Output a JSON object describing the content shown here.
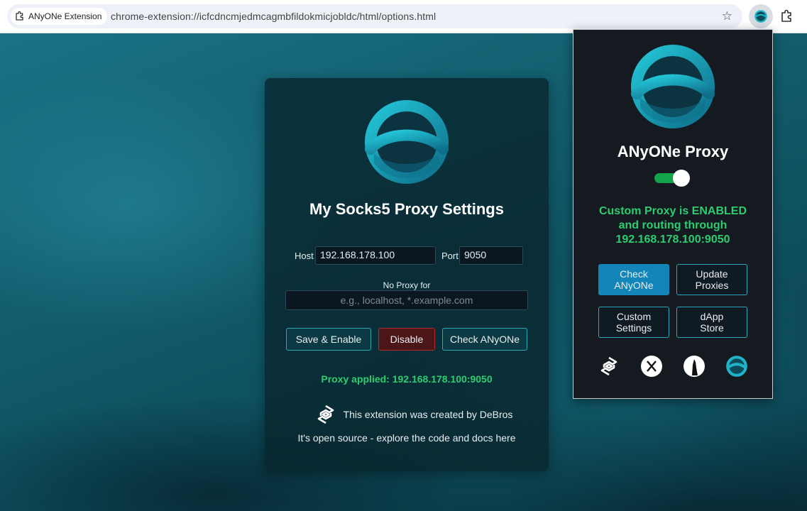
{
  "browser": {
    "site_chip": "ANyONe Extension",
    "url": "chrome-extension://icfcdncmjedmcagmbfildokmicjobldc/html/options.html"
  },
  "options": {
    "title": "My Socks5 Proxy Settings",
    "host_label": "Host",
    "host_value": "192.168.178.100",
    "port_label": "Port",
    "port_value": "9050",
    "noproxy_label": "No Proxy for",
    "noproxy_placeholder": "e.g., localhost, *.example.com",
    "buttons": {
      "save": "Save & Enable",
      "disable": "Disable",
      "check": "Check ANyONe"
    },
    "status": "Proxy applied: 192.168.178.100:9050",
    "credit": "This extension was created by DeBros",
    "footer": "It's open source - explore the code and docs here"
  },
  "popup": {
    "title": "ANyONe Proxy",
    "toggle_on": true,
    "status_line1": "Custom Proxy is ENABLED",
    "status_line2": "and routing through",
    "status_line3": "192.168.178.100:9050",
    "buttons": {
      "check_line1": "Check",
      "check_line2": "ANyONe",
      "update_line1": "Update",
      "update_line2": "Proxies",
      "custom_line1": "Custom",
      "custom_line2": "Settings",
      "dapp_line1": "dApp",
      "dapp_line2": "Store"
    },
    "social_icons": [
      "debros-icon",
      "x-icon",
      "wolf-icon",
      "anyone-icon"
    ]
  },
  "colors": {
    "accent_teal": "#2aa8b8",
    "success_green": "#2ecc71",
    "danger_red": "#b02b2b",
    "primary_blue": "#1485b8"
  }
}
